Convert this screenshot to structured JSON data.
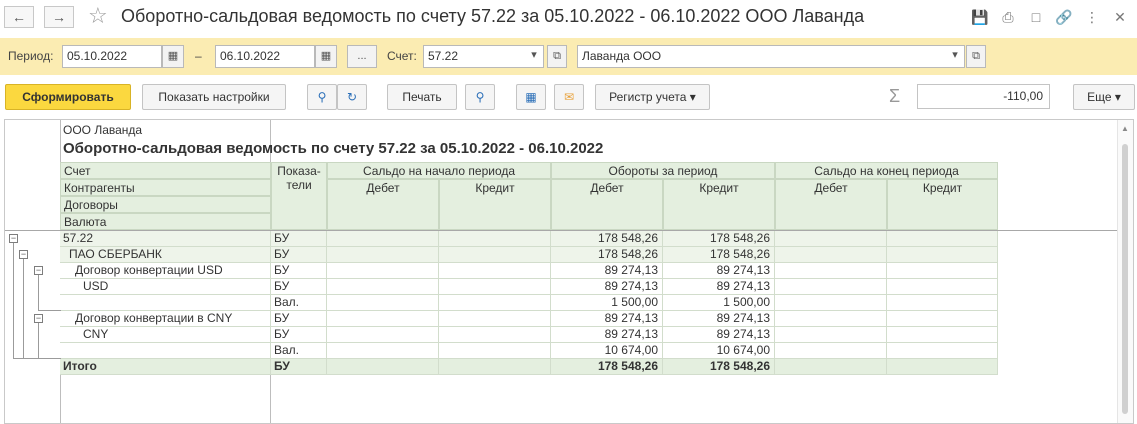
{
  "window": {
    "title": "Оборотно-сальдовая ведомость по счету 57.22 за 05.10.2022 - 06.10.2022 ООО Лаванда"
  },
  "params": {
    "period_label": "Период:",
    "date_from": "05.10.2022",
    "dash": "–",
    "date_to": "06.10.2022",
    "more_label": "...",
    "account_label": "Счет:",
    "account_value": "57.22",
    "org_value": "Лаванда ООО"
  },
  "toolbar": {
    "generate_label": "Сформировать",
    "settings_label": "Показать настройки",
    "print_label": "Печать",
    "register_label": "Регистр учета",
    "sum_value": "-110,00",
    "more_label": "Еще"
  },
  "report": {
    "org_name": "ООО Лаванда",
    "title": "Оборотно-сальдовая ведомость по счету 57.22 за 05.10.2022 - 06.10.2022",
    "row_headers": [
      "Счет",
      "Контрагенты",
      "Договоры",
      "Валюта"
    ],
    "indicators_header": "Показа-\nтели",
    "group_headers": [
      "Сальдо на начало периода",
      "Обороты за период",
      "Сальдо на конец периода"
    ],
    "sub_headers": [
      "Дебет",
      "Кредит",
      "Дебет",
      "Кредит",
      "Дебет",
      "Кредит"
    ],
    "rows": [
      {
        "name": "57.22",
        "ind": "БУ",
        "d": "178 548,26",
        "c": "178 548,26"
      },
      {
        "name": "ПАО СБЕРБАНК",
        "ind": "БУ",
        "d": "178 548,26",
        "c": "178 548,26"
      },
      {
        "name": "Договор конвертации USD",
        "ind": "БУ",
        "d": "89 274,13",
        "c": "89 274,13"
      },
      {
        "name": "USD",
        "ind": "БУ",
        "d": "89 274,13",
        "c": "89 274,13"
      },
      {
        "name": "",
        "ind": "Вал.",
        "d": "1 500,00",
        "c": "1 500,00"
      },
      {
        "name": "Договор конвертации в CNY",
        "ind": "БУ",
        "d": "89 274,13",
        "c": "89 274,13"
      },
      {
        "name": "CNY",
        "ind": "БУ",
        "d": "89 274,13",
        "c": "89 274,13"
      },
      {
        "name": "",
        "ind": "Вал.",
        "d": "10 674,00",
        "c": "10 674,00"
      }
    ],
    "total": {
      "name": "Итого",
      "ind": "БУ",
      "d": "178 548,26",
      "c": "178 548,26"
    }
  },
  "icons": [
    "back-arrow-icon",
    "forward-arrow-icon",
    "star-icon",
    "save-icon",
    "print-icon",
    "preview-icon",
    "link-icon",
    "more-vertical-icon",
    "close-icon",
    "calendar-icon",
    "dropdown-icon",
    "open-icon",
    "search-icon",
    "search-next-icon",
    "print-preview-icon",
    "save-disk-icon",
    "mail-icon",
    "sigma-icon"
  ]
}
